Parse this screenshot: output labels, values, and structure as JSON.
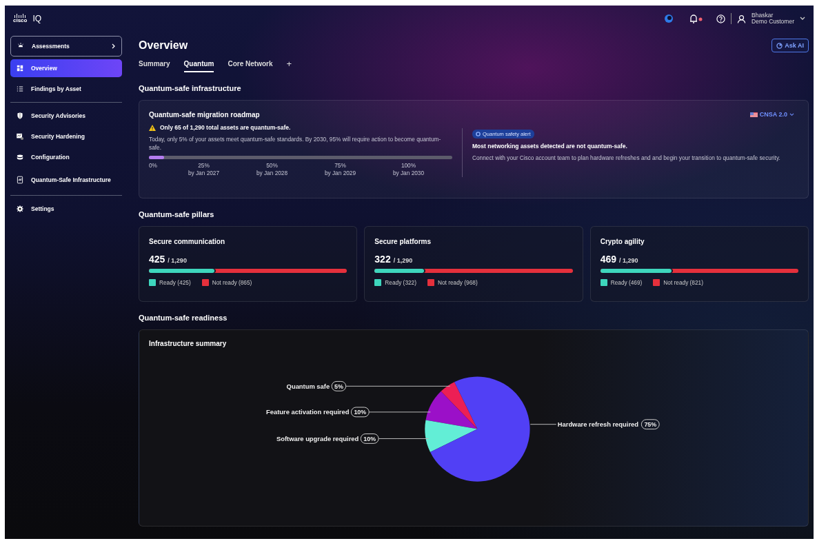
{
  "header": {
    "logo_word": "cisco",
    "product": "IQ",
    "user_name": "Bhaskar",
    "user_org": "Demo Customer"
  },
  "sidebar": {
    "groups": [
      {
        "items": [
          {
            "label": "Assessments",
            "kind": "expandable",
            "selected": false
          },
          {
            "label": "Overview",
            "kind": "link",
            "selected": true
          },
          {
            "label": "Findings by Asset",
            "kind": "link",
            "selected": false
          }
        ]
      },
      {
        "items": [
          {
            "label": "Security Advisories",
            "kind": "link",
            "selected": false
          },
          {
            "label": "Security Hardening",
            "kind": "link",
            "selected": false
          },
          {
            "label": "Configuration",
            "kind": "link",
            "selected": false
          },
          {
            "label": "Quantum-Safe Infrastructure",
            "kind": "link",
            "selected": false
          }
        ]
      },
      {
        "items": [
          {
            "label": "Settings",
            "kind": "link",
            "selected": false
          }
        ]
      }
    ]
  },
  "page": {
    "title": "Overview",
    "ask_ai": "Ask AI"
  },
  "tabs": [
    {
      "label": "Summary",
      "selected": false
    },
    {
      "label": "Quantum",
      "selected": true
    },
    {
      "label": "Core Network",
      "selected": false
    }
  ],
  "add_tab": "+",
  "infrastructure": {
    "heading": "Quantum-safe infrastructure",
    "card_title": "Quantum-safe migration roadmap",
    "standard": "CNSA 2.0",
    "warning": "Only 65 of 1,290 total assets are quantum-safe.",
    "description": "Today, only 5% of your assets meet quantum-safe standards. By 2030, 95% will require action to become quantum-safe.",
    "progress": {
      "level": 0.05
    },
    "milestones": [
      {
        "percent": "0%"
      },
      {
        "percent": "25%",
        "date": "by Jan 2027"
      },
      {
        "percent": "50%",
        "date": "by Jan 2028"
      },
      {
        "percent": "75%",
        "date": "by Jan 2029"
      },
      {
        "percent": "100%",
        "date": "by Jan 2030"
      }
    ],
    "alert_badge": "Quantum safety alert",
    "alert_title": "Most networking assets detected are not quantum-safe.",
    "alert_text": "Connect with your Cisco account team to plan hardware refreshes and and begin your transition to quantum-safe security."
  },
  "pillars": {
    "heading": "Quantum-safe pillars",
    "items": [
      {
        "title": "Secure communication",
        "count": "425",
        "total": "/ 1,290",
        "level": 0.33,
        "legend": [
          {
            "label": "Ready (425)",
            "color": "#3ed6bd"
          },
          {
            "label": "Not ready (865)",
            "color": "#e5303c"
          }
        ]
      },
      {
        "title": "Secure platforms",
        "count": "322",
        "total": "/ 1,290",
        "level": 0.25,
        "legend": [
          {
            "label": "Ready (322)",
            "color": "#3ed6bd"
          },
          {
            "label": "Not ready (968)",
            "color": "#e5303c"
          }
        ]
      },
      {
        "title": "Crypto agility",
        "count": "469",
        "total": "/ 1,290",
        "level": 0.36,
        "legend": [
          {
            "label": "Ready (469)",
            "color": "#3ed6bd"
          },
          {
            "label": "Not ready (821)",
            "color": "#e5303c"
          }
        ]
      }
    ]
  },
  "readiness": {
    "heading": "Quantum-safe readiness",
    "card_title": "Infrastructure summary",
    "chart_data": {
      "type": "pie",
      "categories": [
        "Quantum safe",
        "Feature activation required",
        "Software upgrade required",
        "Hardware refresh required"
      ],
      "values": [
        5,
        10,
        10,
        75
      ],
      "colors": [
        "#ec1f55",
        "#9b10c8",
        "#62eed6",
        "#5140f5"
      ],
      "value_labels": [
        "5%",
        "10%",
        "10%",
        "75%"
      ]
    }
  }
}
